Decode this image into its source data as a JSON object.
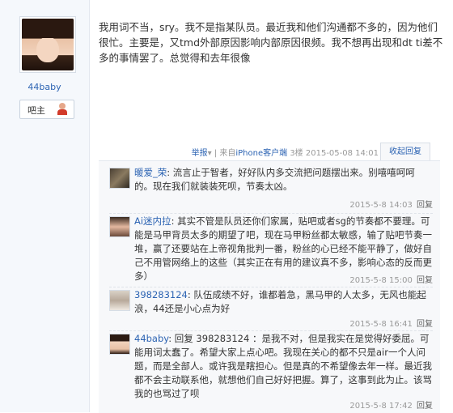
{
  "post": {
    "author": {
      "username": "44baby",
      "badge_label": "吧主"
    },
    "content": "我用词不当，sry。我不是指某队员。最近我和他们沟通都不多的，因为他们很忙。主要是，又tmd外部原因影响内部原因很频。我不想再出现和dt ti差不多的事情罢了。总觉得和去年很像",
    "tail": {
      "report": "举报",
      "report_arrow": "▾",
      "from_prefix": "| 来自",
      "from_client": "iPhone客户端",
      "floor": "3楼",
      "datetime": "2015-05-08 14:01",
      "collapse_label": "收起回复"
    }
  },
  "comments": [
    {
      "name": "暖爱_荣",
      "text": "流言止于智者，好好队内多交流把问题摆出来。别嘻嘻呵呵的。现在我们就装装死呗，节奏太凶。",
      "time": "2015-5-8 14:03",
      "reply": "回复"
    },
    {
      "name": "Ai迷内拉",
      "text": "其实不管是队员还你们家属，贴吧或者sg的节奏都不要理。可能是马甲背员太多的期望了吧，现在马甲粉丝都太敏感，输了贴吧节奏一堆，赢了还要站在上帝视角批判一番，粉丝的心已经不能平静了，做好自己不用管网络上的这些（其实正在有用的建议真不多，影响心态的反而更多）",
      "time": "2015-5-8 15:00",
      "reply": "回复"
    },
    {
      "name": "398283124",
      "text": "队伍成绩不好，谁都着急，黑马甲的人太多，无风也能起浪，44还是小心点为好",
      "time": "2015-5-8 16:41",
      "reply": "回复"
    },
    {
      "name": "44baby",
      "text": "回复 398283124 ：是我不对，但是我实在是觉得好委屈。可能用词太蠢了。希望大家上点心吧。我现在关心的都不只是air一个人问题，而是全部人。或许我是瞎担心。但是真的不希望像去年一样。最近我都不会主动联系他，就想他们自己好好把握。算了，这事到此为止。该骂我的也骂过了呗",
      "time": "2015-5-8 17:42",
      "reply": "回复"
    }
  ]
}
